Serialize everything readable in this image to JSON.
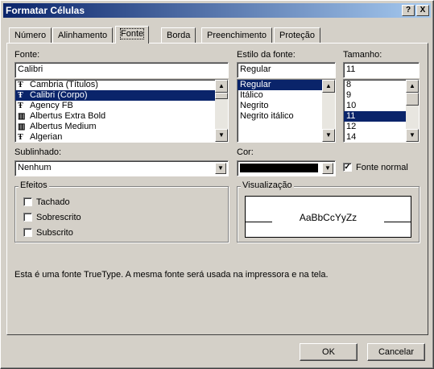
{
  "title": "Formatar Células",
  "title_buttons": {
    "help": "?",
    "close": "X"
  },
  "tabs": [
    "Número",
    "Alinhamento",
    "Fonte",
    "Borda",
    "Preenchimento",
    "Proteção"
  ],
  "font": {
    "label": "Fonte:",
    "value": "Calibri",
    "items": [
      "Cambria (Títulos)",
      "Calibri (Corpo)",
      "Agency FB",
      "Albertus Extra Bold",
      "Albertus Medium",
      "Algerian"
    ],
    "selected_index": 1
  },
  "style": {
    "label": "Estilo da fonte:",
    "value": "Regular",
    "items": [
      "Regular",
      "Itálico",
      "Negrito",
      "Negrito itálico"
    ],
    "selected_index": 0
  },
  "size": {
    "label": "Tamanho:",
    "value": "11",
    "items": [
      "8",
      "9",
      "10",
      "11",
      "12",
      "14"
    ],
    "selected_index": 3
  },
  "underline": {
    "label": "Sublinhado:",
    "value": "Nenhum"
  },
  "color": {
    "label": "Cor:",
    "value_color": "#000000"
  },
  "normal_font": {
    "label": "Fonte normal",
    "checked": true
  },
  "effects": {
    "title": "Efeitos",
    "items": [
      {
        "label": "Tachado",
        "checked": false
      },
      {
        "label": "Sobrescrito",
        "checked": false
      },
      {
        "label": "Subscrito",
        "checked": false
      }
    ]
  },
  "preview": {
    "title": "Visualização",
    "sample": "AaBbCcYyZz"
  },
  "info_text": "Esta é uma fonte TrueType. A mesma fonte será usada na impressora e na tela.",
  "buttons": {
    "ok": "OK",
    "cancel": "Cancelar"
  },
  "colors": {
    "title_start": "#0a246a",
    "title_end": "#a6caf0",
    "selection": "#0a246a",
    "face": "#d4d0c8"
  }
}
